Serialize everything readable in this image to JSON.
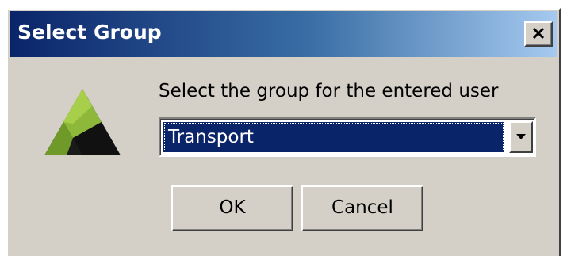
{
  "dialog": {
    "title": "Select Group",
    "close_icon": "close-x-icon",
    "logo_icon": "triangle-logo-icon",
    "prompt": "Select the group for the entered user",
    "group_select": {
      "selected": "Transport",
      "arrow_icon": "dropdown-arrow-icon"
    },
    "ok_label": "OK",
    "cancel_label": "Cancel"
  },
  "colors": {
    "titlebar_start": "#0a246a",
    "titlebar_end": "#a6caf0",
    "selection": "#0a246a",
    "face": "#d4d0c8",
    "logo_green": "#8db83a",
    "logo_dark": "#1a1a1a"
  }
}
